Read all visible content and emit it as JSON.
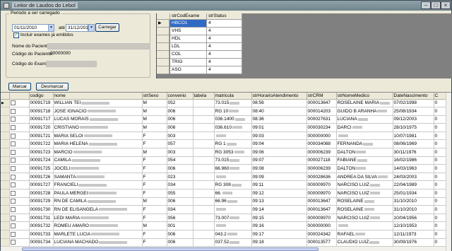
{
  "window": {
    "title": "Leitor de Laudos do Lebol"
  },
  "period": {
    "legend": "Periodo a ser carregado",
    "start_date": "01/11/2010",
    "separator": "até",
    "end_date": "31/12/2010",
    "load_button": "Carregar",
    "include_checkbox": "Incluir exames já emitidos",
    "include_checked": true
  },
  "filters": {
    "patient_name_label": "Nome do Paciente:",
    "patient_code_label": "Código do Paciente:",
    "patient_code_value": "00000000",
    "exam_code_label": "Código do Exame:"
  },
  "actions": {
    "mark_button": "Marcar",
    "unmark_button": "Desmarcar"
  },
  "exam_grid": {
    "columns": [
      "strCodExame",
      "strStatus"
    ],
    "rows": [
      [
        "HBCO1",
        "4"
      ],
      [
        "VHS",
        "4"
      ],
      [
        "HDL",
        "4"
      ],
      [
        "LDL",
        "4"
      ],
      [
        "COL",
        "4"
      ],
      [
        "TRIG",
        "4"
      ],
      [
        "ASO",
        "4"
      ]
    ],
    "selected_color": "#316ac5"
  },
  "main_grid": {
    "columns": [
      "",
      "codigo",
      "nome",
      "strSexo",
      "convenio",
      "tabela",
      "matricula",
      "strHorarioAtendimento",
      "strCRM",
      "strNomeMedico",
      "DateNascimento",
      "C"
    ],
    "rows": [
      [
        "00091719",
        "WILLIAN TEI",
        "M",
        "052",
        "",
        "73.015",
        "08:56",
        "000013647",
        "ROSELAINE MARIA",
        "07/02/1998",
        "0"
      ],
      [
        "00091718",
        "JOSE IGNACIO",
        "M",
        "006",
        "",
        "RG 10",
        "08:40",
        "000014203",
        "GUIDO B ARANHA",
        "25/08/1934",
        "0"
      ],
      [
        "00091717",
        "LUCAS MORAIS",
        "M",
        "006",
        "",
        "036.1400",
        "08:36",
        "000027631",
        "LUCIANA",
        "09/12/2003",
        "0"
      ],
      [
        "00091720",
        "CRISTIANO",
        "M",
        "006",
        "",
        "036.610",
        "09:01",
        "000030234",
        "DARCI",
        "28/10/1975",
        "0"
      ],
      [
        "00091721",
        "MARIA SELOI",
        "F",
        "003",
        "",
        "",
        "09:03",
        "000000000",
        "",
        "10/07/1981",
        "0"
      ],
      [
        "00091722",
        "MARIA HELENA",
        "F",
        "057",
        "",
        "RG 1",
        "09:04",
        "000034088",
        "FERNANDA",
        "08/06/1969",
        "0"
      ],
      [
        "00091723",
        "MARCIO",
        "M",
        "003",
        "",
        "RG 3053",
        "09:06",
        "000006239",
        "DALTON",
        "30/11/1976",
        "0"
      ],
      [
        "00091724",
        "CAMILA",
        "F",
        "054",
        "",
        "73.015",
        "09:07",
        "000027118",
        "FABIANE",
        "16/02/1986",
        "0"
      ],
      [
        "00091725",
        "JOCELI",
        "F",
        "006",
        "",
        "66.960",
        "09:08",
        "000006239",
        "DALTON",
        "14/03/1963",
        "0"
      ],
      [
        "00091726",
        "SAMANTA",
        "F",
        "023",
        "",
        "",
        "09:09",
        "000028636",
        "ANDREA DA SILVA",
        "24/03/2003",
        "0"
      ],
      [
        "00091727",
        "FRANCIELI",
        "F",
        "034",
        "",
        "RG 308",
        "09:11",
        "000009970",
        "NARCISO LUIZ",
        "22/04/1989",
        "0"
      ],
      [
        "00091728",
        "PAULA MERGEI",
        "F",
        "055",
        "",
        "66.",
        "09:12",
        "000009970",
        "NARCISO LUIZ",
        "25/01/1934",
        "0"
      ],
      [
        "00091729",
        "RN DE CAMILA",
        "M",
        "006",
        "",
        "66.96",
        "09:13",
        "000013647",
        "ROSELAINE",
        "31/10/2010",
        "0"
      ],
      [
        "00091730",
        "RN DE ELISANGELA",
        "F",
        "034",
        "",
        "",
        "09:14",
        "000013647",
        "ROSELAINE",
        "31/10/2010",
        "0"
      ],
      [
        "00091731",
        "LEDI MARIA",
        "F",
        "056",
        "",
        "73.007",
        "09:15",
        "000009970",
        "NARCISO LUIZ",
        "10/04/1956",
        "0"
      ],
      [
        "00091732",
        "ROMEU AMARO",
        "M",
        "001",
        "",
        "",
        "09:16",
        "000000000",
        "",
        "12/10/1953",
        "0"
      ],
      [
        "00091733",
        "MARLETE LUCIA",
        "F",
        "006",
        "",
        "043.2",
        "09:17",
        "000024342",
        "RAFAEL",
        "12/11/1973",
        "0"
      ],
      [
        "00091734",
        "LUCIANA MACHADO",
        "F",
        "006",
        "",
        "037.52",
        "09:18",
        "000013577",
        "CLAUDIO LUIZ",
        "30/09/1976",
        "0"
      ]
    ]
  }
}
